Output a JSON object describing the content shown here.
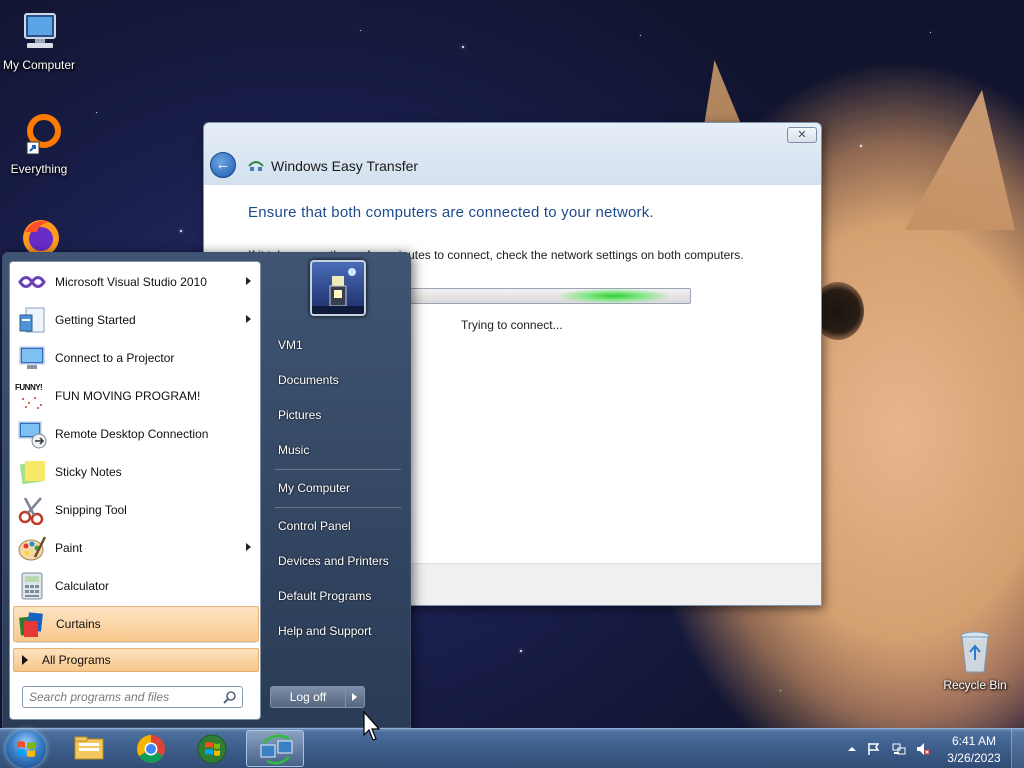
{
  "desktop": {
    "icons": [
      {
        "label": "My Computer",
        "icon": "computer-icon"
      },
      {
        "label": "Everything",
        "icon": "everything-search-icon"
      },
      {
        "label": "",
        "icon": "firefox-icon"
      },
      {
        "label": "Recycle Bin",
        "icon": "recycle-bin-icon"
      }
    ]
  },
  "transfer_window": {
    "title": "Windows Easy Transfer",
    "close_label": "✕",
    "heading": "Ensure that both computers are connected to your network.",
    "description": "If it takes more than a few minutes to connect, check the network settings on both computers.",
    "progress_status": "Trying to connect..."
  },
  "start_menu": {
    "programs": [
      {
        "label": "Microsoft Visual Studio 2010",
        "icon": "visual-studio-icon",
        "submenu": true
      },
      {
        "label": "Getting Started",
        "icon": "getting-started-icon",
        "submenu": true
      },
      {
        "label": "Connect to a Projector",
        "icon": "projector-icon",
        "submenu": false
      },
      {
        "label": "FUN MOVING PROGRAM!",
        "icon": "funny-program-icon",
        "submenu": false
      },
      {
        "label": "Remote Desktop Connection",
        "icon": "remote-desktop-icon",
        "submenu": false
      },
      {
        "label": "Sticky Notes",
        "icon": "sticky-notes-icon",
        "submenu": false
      },
      {
        "label": "Snipping Tool",
        "icon": "snipping-tool-icon",
        "submenu": false
      },
      {
        "label": "Paint",
        "icon": "paint-icon",
        "submenu": true
      },
      {
        "label": "Calculator",
        "icon": "calculator-icon",
        "submenu": false
      },
      {
        "label": "Curtains",
        "icon": "curtains-icon",
        "submenu": false
      }
    ],
    "funny_icon_text": "FUNNY!",
    "all_programs": "All Programs",
    "search_placeholder": "Search programs and files",
    "places": [
      "VM1",
      "Documents",
      "Pictures",
      "Music",
      "My Computer",
      "Control Panel",
      "Devices and Printers",
      "Default Programs",
      "Help and Support"
    ],
    "logoff_label": "Log off"
  },
  "taskbar": {
    "pinned": [
      {
        "icon": "file-explorer-icon"
      },
      {
        "icon": "chrome-icon"
      },
      {
        "icon": "media-player-icon"
      },
      {
        "icon": "easy-transfer-icon",
        "active": true
      }
    ],
    "tray": {
      "time": "6:41 AM",
      "date": "3/26/2023"
    }
  }
}
